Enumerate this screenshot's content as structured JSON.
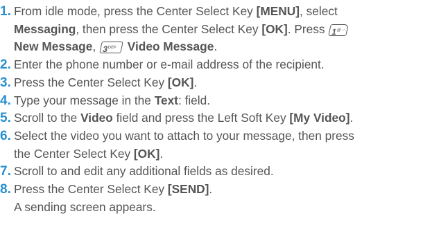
{
  "steps": [
    {
      "num": "1.",
      "line1": {
        "a": "From idle mode, press the Center Select Key ",
        "b": "[MENU]",
        "c": ", select"
      },
      "line2": {
        "a": "Messaging",
        "b": ", then press the Center Select Key ",
        "c": "[OK]",
        "d": ". Press"
      },
      "key1": {
        "big": "1",
        "small": "@ .:-"
      },
      "line3": {
        "a": "New Message",
        "b": ", ",
        "c": "Video Message",
        "d": "."
      },
      "key3": {
        "big": "3",
        "small": "DEF"
      }
    },
    {
      "num": "2.",
      "text": "Enter the phone number or e-mail address of the recipient."
    },
    {
      "num": "3.",
      "a": "Press the Center Select Key ",
      "b": "[OK]",
      "c": "."
    },
    {
      "num": "4.",
      "a": "Type your message in the ",
      "b": "Text",
      "c": ": field."
    },
    {
      "num": "5.",
      "a": "Scroll to the ",
      "b": "Video",
      "c": " field and press the Left Soft Key ",
      "d": "[My Video]",
      "e": "."
    },
    {
      "num": "6.",
      "line1": "Select the video you want to attach to your message, then press",
      "line2": {
        "a": "the Center Select Key ",
        "b": "[OK]",
        "c": "."
      }
    },
    {
      "num": "7.",
      "text": "Scroll to and edit any additional fields as desired."
    },
    {
      "num": "8.",
      "a": "Press the Center Select Key ",
      "b": "[SEND]",
      "c": "."
    }
  ],
  "note": "A sending screen appears.",
  "colors": {
    "step_number": "#2a8fcf",
    "text": "#555555"
  }
}
